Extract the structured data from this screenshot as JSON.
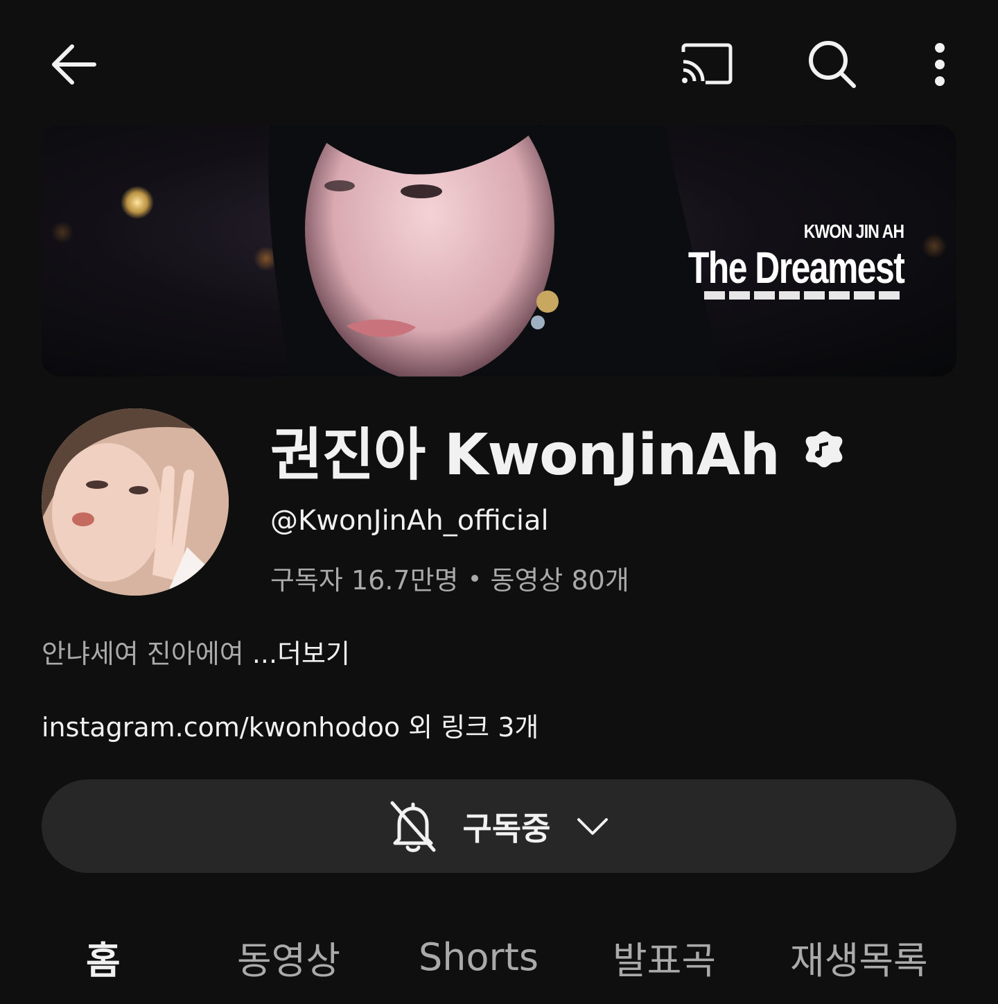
{
  "topbar": {
    "icons": [
      "back-arrow-icon",
      "cast-icon",
      "search-icon",
      "more-vert-icon"
    ]
  },
  "banner": {
    "artist": "KWON JIN AH",
    "album": "The Dreamest"
  },
  "channel": {
    "name": "권진아 KwonJinAh",
    "handle": "@KwonJinAh_official",
    "subscribers": "구독자 16.7만명",
    "videos": "동영상 80개",
    "description": "안냐세여 진아에여 ",
    "description_more": "...더보기",
    "links": "instagram.com/kwonhodoo 외 링크 3개",
    "verified_icon": "music-note-verified-icon"
  },
  "subscribe": {
    "label": "구독중",
    "bell_icon": "bell-off-icon",
    "chevron_icon": "chevron-down-icon"
  },
  "tabs": [
    {
      "label": "홈",
      "active": true
    },
    {
      "label": "동영상",
      "active": false
    },
    {
      "label": "Shorts",
      "active": false
    },
    {
      "label": "발표곡",
      "active": false
    },
    {
      "label": "재생목록",
      "active": false
    }
  ],
  "colors": {
    "background": "#0f0f0f",
    "text_primary": "#f1f1f1",
    "text_secondary": "#aaaaaa",
    "button_bg": "#272727"
  }
}
